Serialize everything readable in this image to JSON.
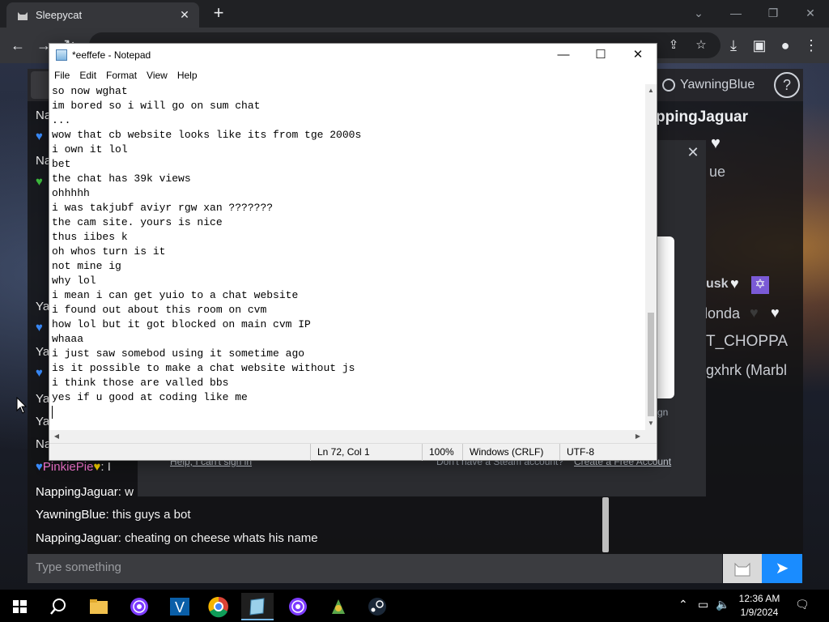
{
  "browser": {
    "tab_title": "Sleepycat",
    "tab_close_icon": "close-icon",
    "new_tab_icon": "plus-icon"
  },
  "webapp": {
    "current_user": "YawningBlue",
    "help_label": "?",
    "chat_messages_left": [
      {
        "text": "Na"
      },
      {
        "text": "Na"
      },
      {
        "text": "Ya"
      },
      {
        "text": "Ya"
      },
      {
        "text": "Ya"
      },
      {
        "text": "Ya"
      },
      {
        "text": "Na"
      }
    ],
    "side_names": [
      "ppingJaguar",
      "ue",
      "usk",
      "londa",
      "T_CHOPPA",
      "gxhrk (Marbl"
    ],
    "pinkie_line": "PinkiePie",
    "pinkie_suffix": ": I",
    "bottom_messages": [
      {
        "user": "NappingJaguar",
        "text": ": w"
      },
      {
        "user": "YawningBlue",
        "text": ": this guys a bot"
      },
      {
        "user": "NappingJaguar",
        "text": ": cheating on cheese whats his name"
      }
    ],
    "modal": {
      "sign_in_hint": "gn",
      "help_link": "Help, I can't sign in",
      "no_account": "Don't have a Steam account?",
      "create_link": "Create a Free Account"
    },
    "input_placeholder": "Type something"
  },
  "notepad": {
    "title": "*eeffefe - Notepad",
    "menu": [
      "File",
      "Edit",
      "Format",
      "View",
      "Help"
    ],
    "lines": [
      "so now wghat",
      "im bored so i will go on sum chat",
      "...",
      "wow that cb website looks like its from tge 2000s",
      "i own it lol",
      "bet",
      "the chat has 39k views",
      "ohhhhh",
      "i was takjubf aviyr rgw xan ???????",
      "the cam site. yours is nice",
      "thus iibes k",
      "oh whos turn is it",
      "not mine ig",
      "why lol",
      "i mean i can get yuio to a chat website",
      "i found out about this room on cvm",
      "how lol but it got blocked on main cvm IP",
      "whaaa",
      "i just saw somebod using it sometime ago",
      "is it possible to make a chat website without js",
      "i think those are valled bbs",
      "yes if u good at coding like me",
      ""
    ],
    "status": {
      "position": "Ln 72, Col 1",
      "zoom": "100%",
      "line_ending": "Windows (CRLF)",
      "encoding": "UTF-8"
    }
  },
  "taskbar": {
    "clock_time": "12:36 AM",
    "clock_date": "1/9/2024"
  }
}
